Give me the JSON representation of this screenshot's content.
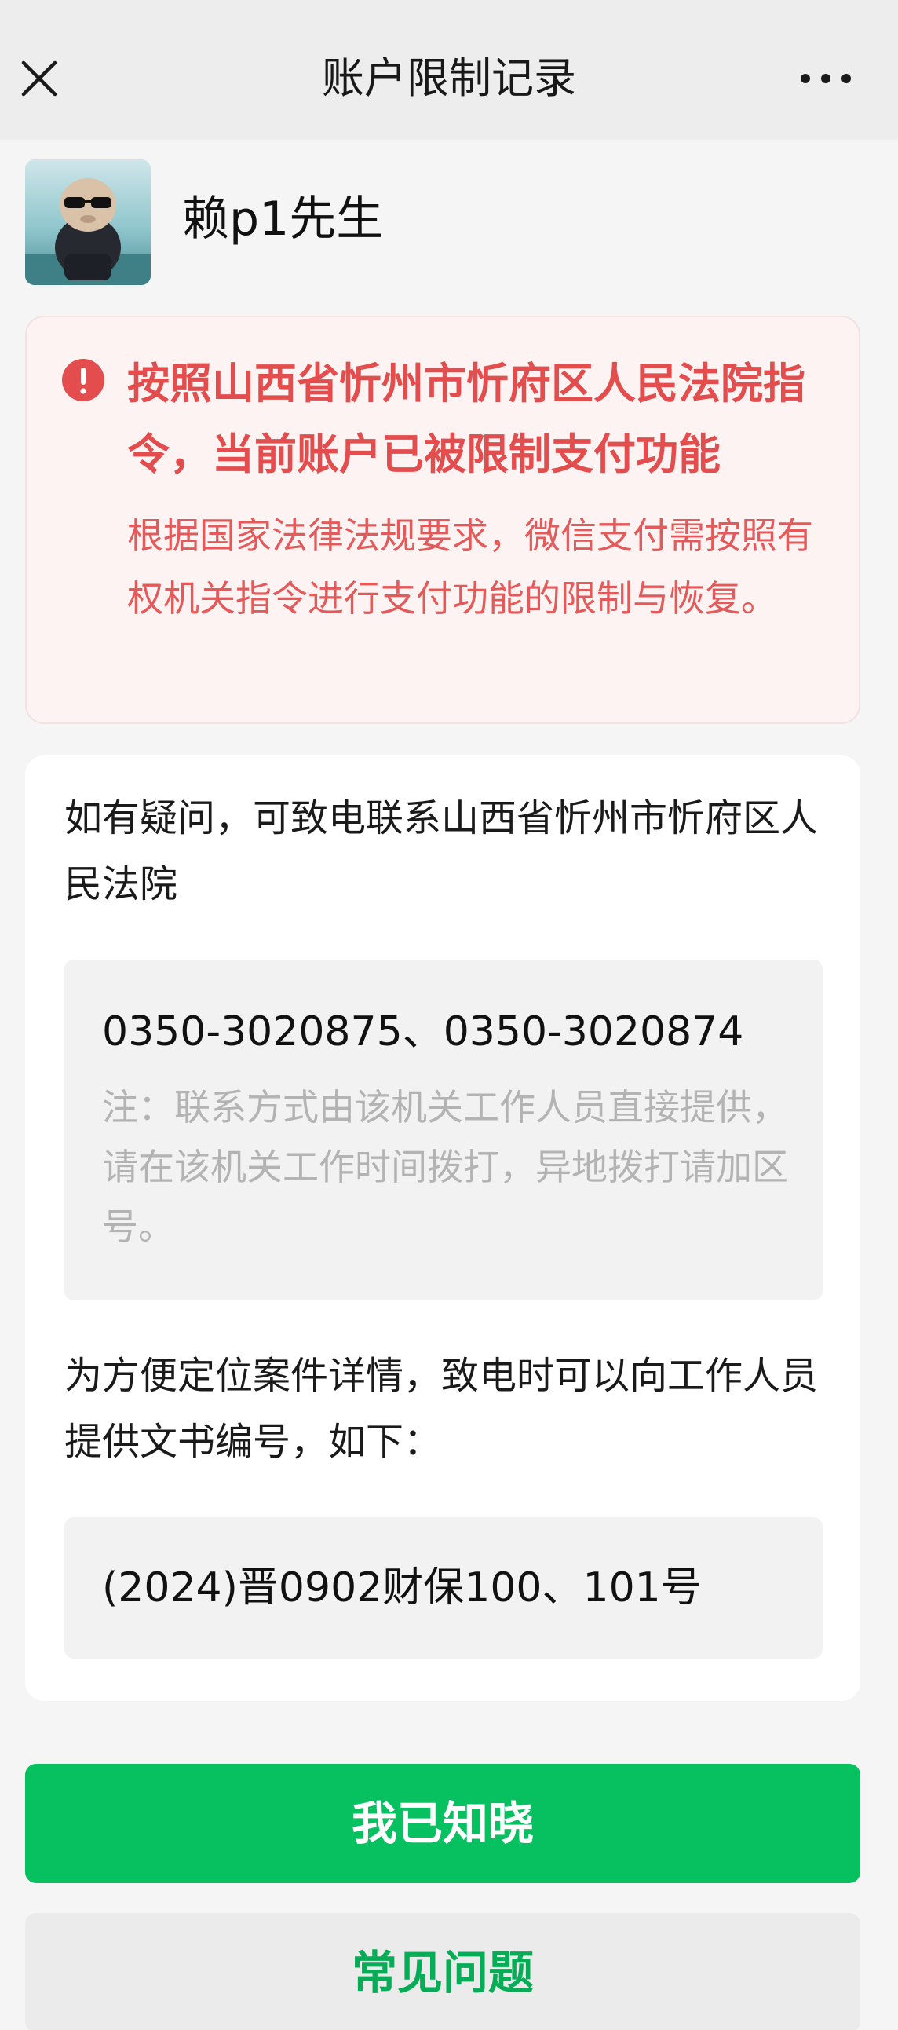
{
  "nav": {
    "title": "账户限制记录",
    "close_icon": "close-icon",
    "more_icon": "more-icon"
  },
  "user": {
    "name": "赖p1先生",
    "avatar_icon": "avatar-image"
  },
  "alert": {
    "icon": "exclamation-circle-icon",
    "title": "按照山西省忻州市忻府区人民法院指令，当前账户已被限制支付功能",
    "description": "根据国家法律法规要求，微信支付需按照有权机关指令进行支付功能的限制与恢复。"
  },
  "contact": {
    "intro": "如有疑问，可致电联系山西省忻州市忻府区人民法院",
    "phones": "0350-3020875、0350-3020874",
    "note": "注：联系方式由该机关工作人员直接提供，请在该机关工作时间拨打，异地拨打请加区号。",
    "doc_intro": "为方便定位案件详情，致电时可以向工作人员提供文书编号，如下：",
    "doc_number": "(2024)晋0902财保100、101号"
  },
  "buttons": {
    "confirm": "我已知晓",
    "faq": "常见问题"
  },
  "colors": {
    "brand_green": "#07c160",
    "alert_red": "#e44d4d",
    "alert_bg": "#fdf3f3"
  }
}
